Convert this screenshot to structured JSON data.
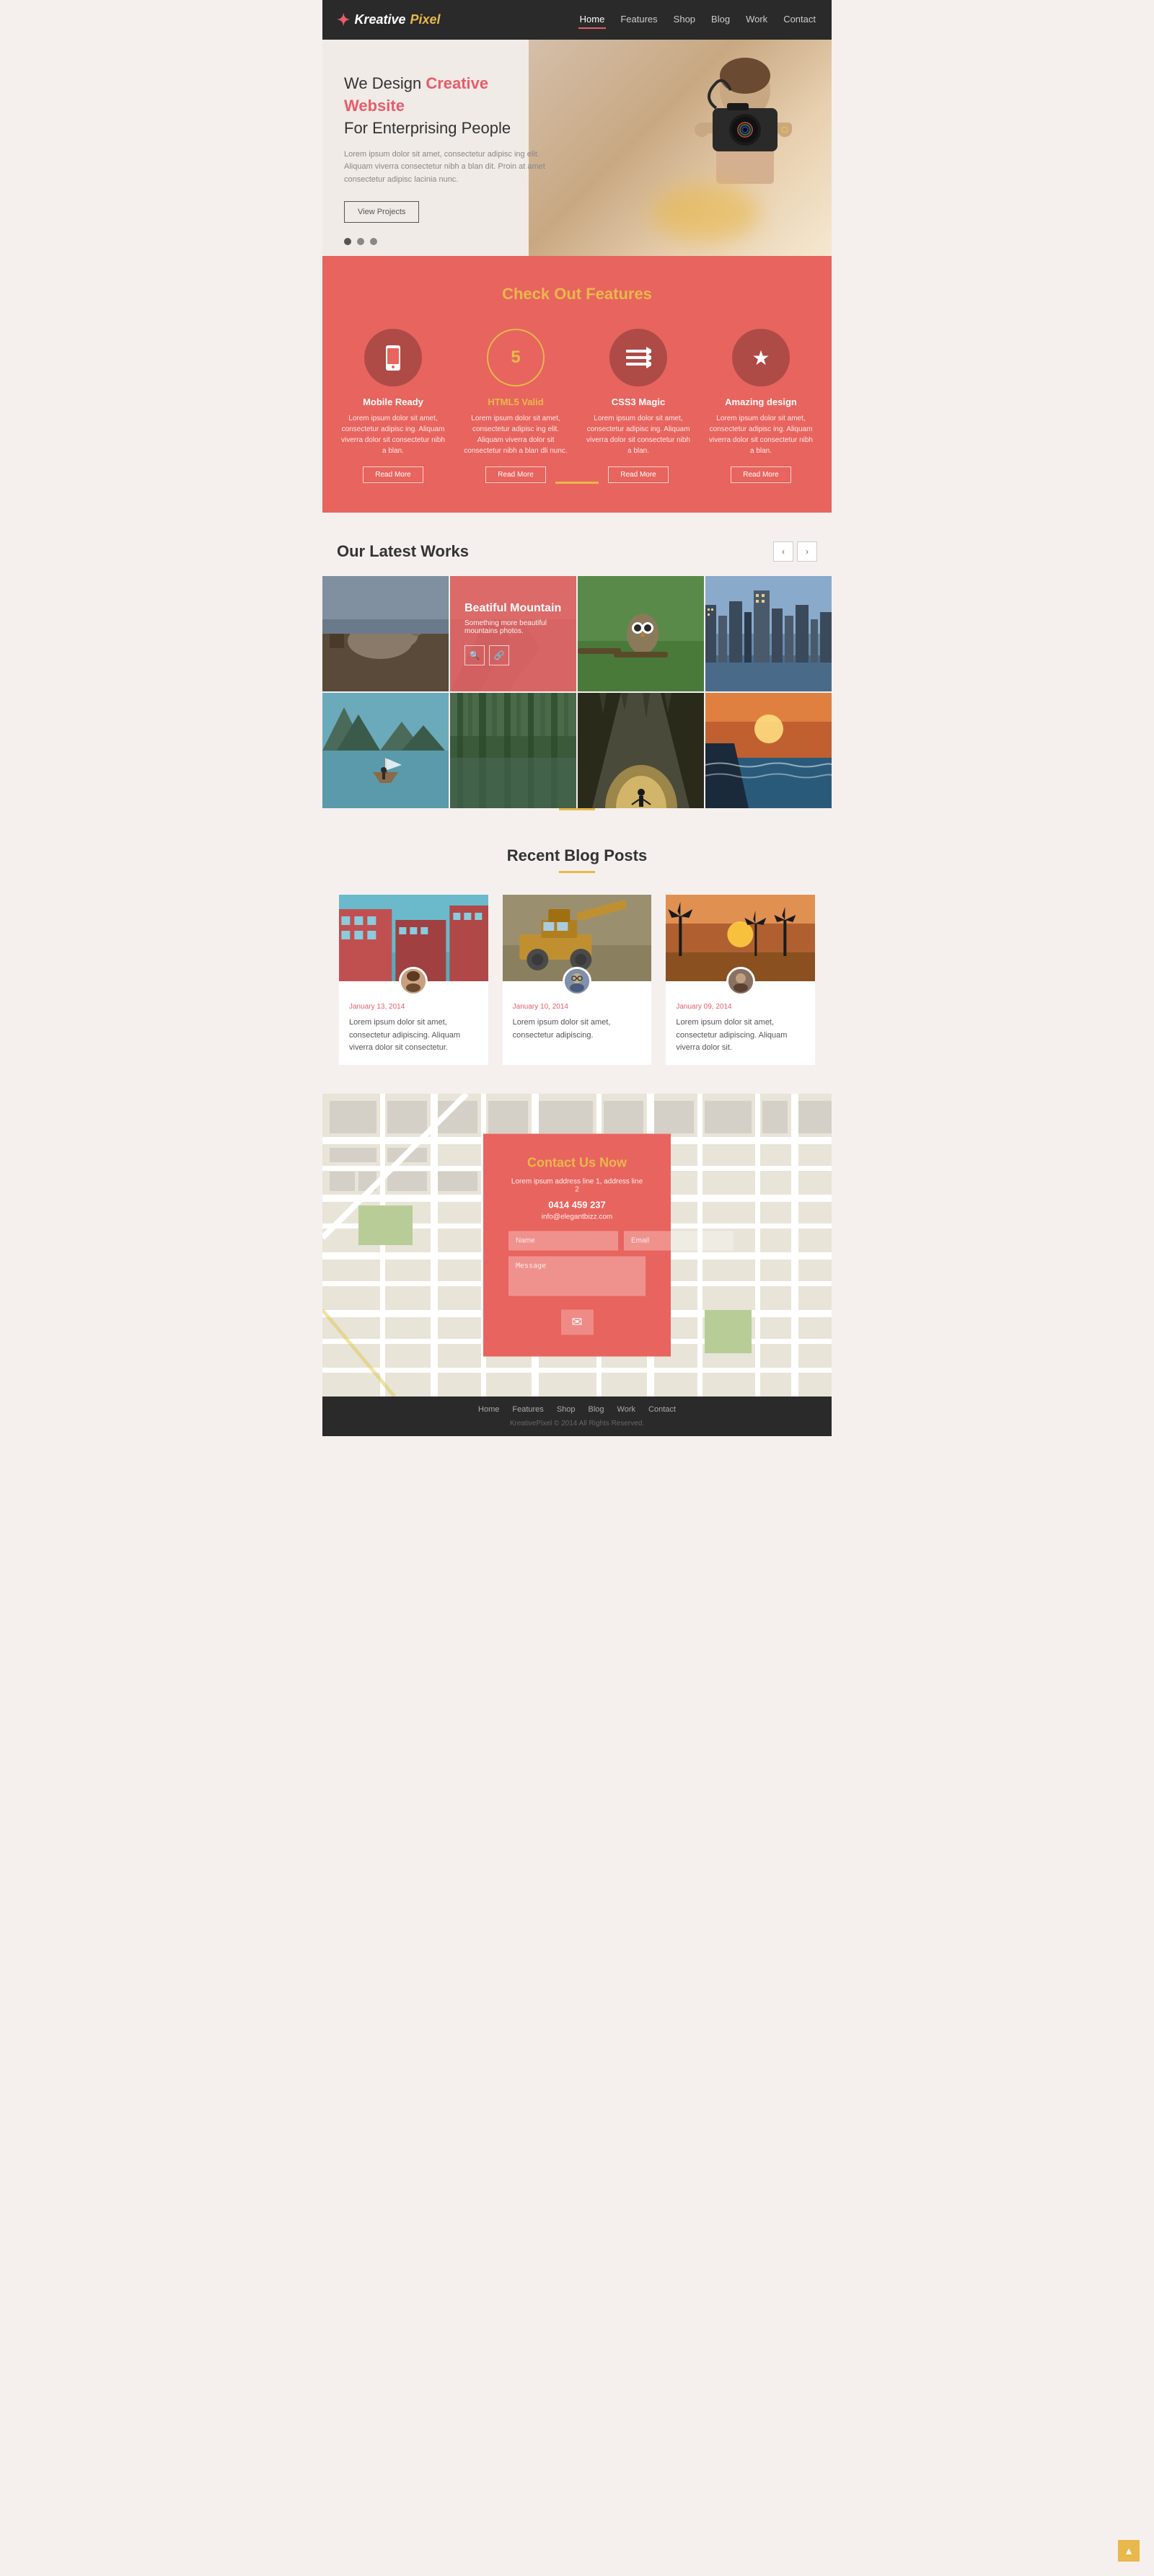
{
  "nav": {
    "logo_kreative": "Kreative",
    "logo_pixel": "Pixel",
    "links": [
      {
        "label": "Home",
        "active": true
      },
      {
        "label": "Features",
        "active": false
      },
      {
        "label": "Shop",
        "active": false
      },
      {
        "label": "Blog",
        "active": false
      },
      {
        "label": "Work",
        "active": false
      },
      {
        "label": "Contact",
        "active": false
      }
    ]
  },
  "hero": {
    "headline_plain": "We Design",
    "headline_colored": "Creative Website",
    "headline_2": "For Enterprising People",
    "body": "Lorem ipsum dolor sit amet, consectetur adipisc ing elit. Aliquam viverra consectetur nibh a blan dit. Proin at amet consectetur adipisc lacinia nunc.",
    "btn_label": "View Projects",
    "dot1": "active",
    "dot2": "",
    "dot3": ""
  },
  "features": {
    "section_title_plain": "Check Out",
    "section_title_bold": "Features",
    "items": [
      {
        "icon": "📱",
        "title": "Mobile Ready",
        "highlighted": false,
        "desc": "Lorem ipsum dolor sit amet, consectetur adipisc ing. Aliquam viverra  dolor sit consectetur nibh a blan.",
        "btn": "Read More"
      },
      {
        "icon": "5",
        "title": "HTML5 Valid",
        "highlighted": true,
        "desc": "Lorem ipsum dolor sit amet, consectetur adipisc ing elit. Aliquam viverra  dolor sit consectetur nibh a blan dli nunc.",
        "btn": "Read More"
      },
      {
        "icon": "≡",
        "title": "CSS3 Magic",
        "highlighted": false,
        "desc": "Lorem ipsum dolor sit amet, consectetur adipisc ing. Aliquam viverra  dolor sit consectetur nibh a blan.",
        "btn": "Read More"
      },
      {
        "icon": "★",
        "title": "Amazing design",
        "highlighted": false,
        "desc": "Lorem ipsum dolor sit amet, consectetur adipisc ing. Aliquam viverra  dolor sit consectetur nibh a blan.",
        "btn": "Read More"
      }
    ]
  },
  "works": {
    "section_title_plain": "Our Latest",
    "section_title_bold": "Works",
    "nav_prev": "‹",
    "nav_next": "›",
    "overlay_title": "Beatiful Mountain",
    "overlay_sub": "Something more beautiful mountains photos.",
    "overlay_search_icon": "🔍",
    "overlay_link_icon": "🔗"
  },
  "blog": {
    "section_title_plain": "Recent",
    "section_title_bold": "Blog Posts",
    "posts": [
      {
        "date": "January 13, 2014",
        "text": "Lorem ipsum dolor sit amet, consectetur adipiscing. Aliquam viverra  dolor sit consectetur."
      },
      {
        "date": "January 10, 2014",
        "text": "Lorem ipsum dolor sit amet, consectetur adipiscing."
      },
      {
        "date": "January 09, 2014",
        "text": "Lorem ipsum dolor sit amet, consectetur adipiscing. Aliquam viverra  dolor sit."
      }
    ]
  },
  "contact": {
    "section_title": "Contact Us Now",
    "address1": "Lorem ipsum address line 1, address line 2",
    "phone": "0414 459 237",
    "email": "info@elegantbizz.com",
    "name_placeholder": "Name",
    "email_placeholder": "Email",
    "message_placeholder": "Message",
    "send_icon": "✉"
  },
  "footer": {
    "links": [
      "Home",
      "Features",
      "Shop",
      "Blog",
      "Work",
      "Contact"
    ],
    "copyright": "KreativePixel © 2014 All Rights Reserved."
  },
  "scroll_top": "▲"
}
